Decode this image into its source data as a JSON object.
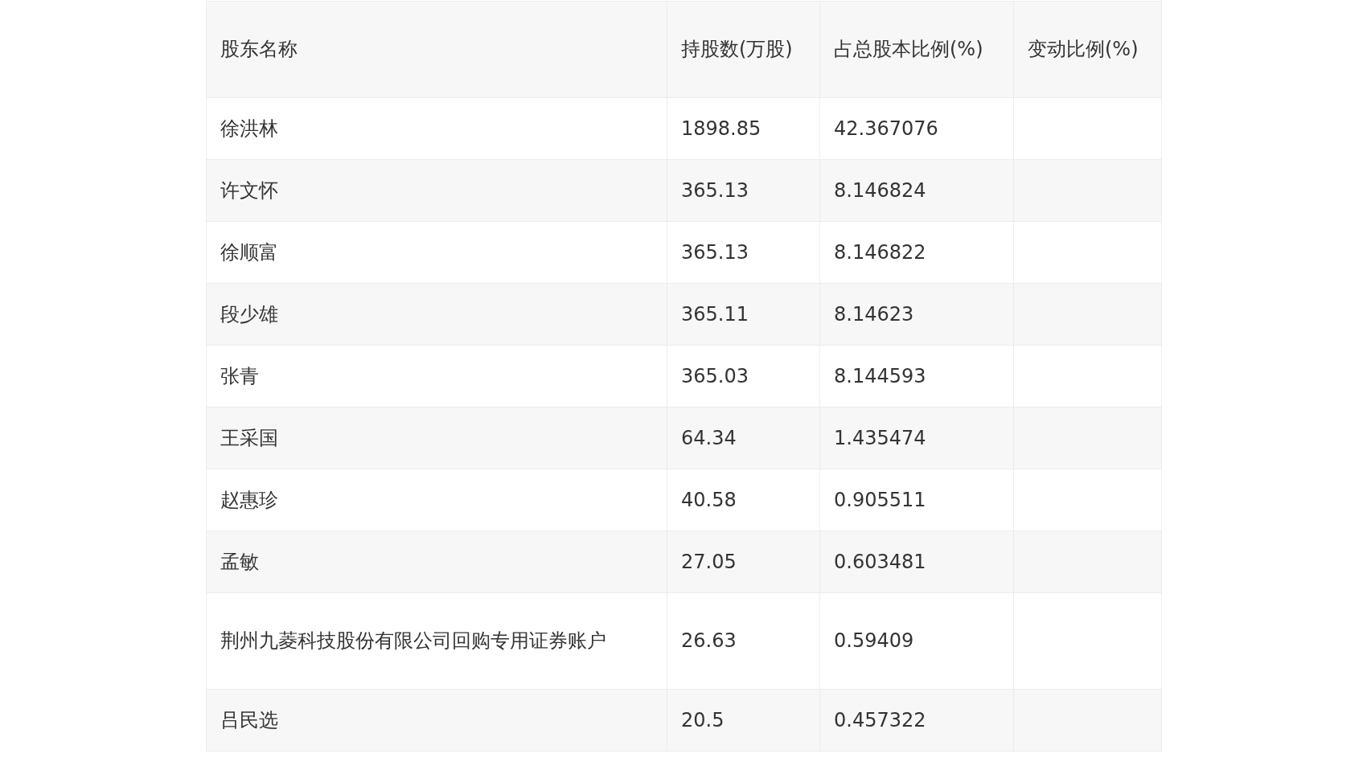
{
  "table": {
    "columns": [
      "股东名称",
      "持股数(万股)",
      "占总股本比例(%)",
      "变动比例(%)"
    ],
    "rows": [
      {
        "name": "徐洪林",
        "shares": "1898.85",
        "ratio": "42.367076"
      },
      {
        "name": "许文怀",
        "shares": "365.13",
        "ratio": "8.146824"
      },
      {
        "name": "徐顺富",
        "shares": "365.13",
        "ratio": "8.146822"
      },
      {
        "name": "段少雄",
        "shares": "365.11",
        "ratio": "8.14623"
      },
      {
        "name": "张青",
        "shares": "365.03",
        "ratio": "8.144593"
      },
      {
        "name": "王采国",
        "shares": "64.34",
        "ratio": "1.435474"
      },
      {
        "name": "赵惠珍",
        "shares": "40.58",
        "ratio": "0.905511"
      },
      {
        "name": "孟敏",
        "shares": "27.05",
        "ratio": "0.603481"
      },
      {
        "name": "荆州九菱科技股份有限公司回购专用证券账户",
        "shares": "26.63",
        "ratio": "0.59409"
      },
      {
        "name": "吕民选",
        "shares": "20.5",
        "ratio": "0.457322"
      }
    ]
  }
}
